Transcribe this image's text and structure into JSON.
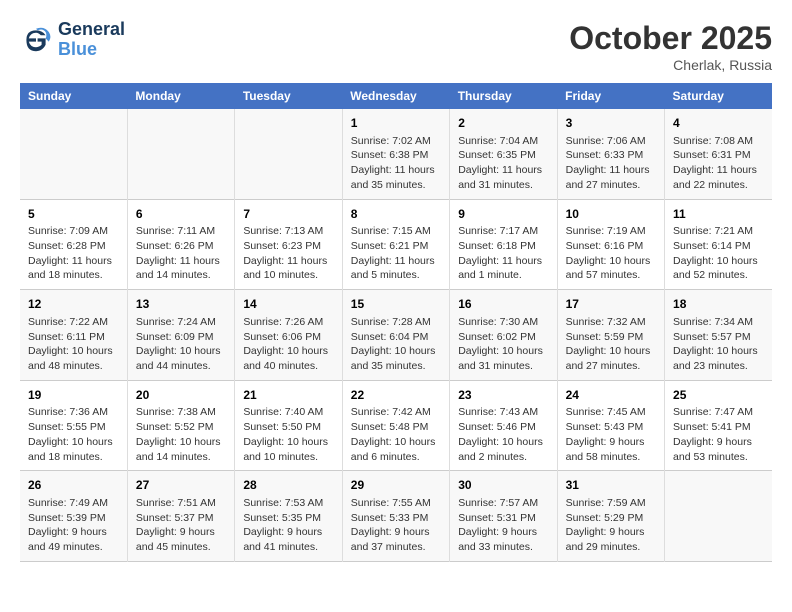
{
  "header": {
    "logo_line1": "General",
    "logo_line2": "Blue",
    "month": "October 2025",
    "location": "Cherlak, Russia"
  },
  "weekdays": [
    "Sunday",
    "Monday",
    "Tuesday",
    "Wednesday",
    "Thursday",
    "Friday",
    "Saturday"
  ],
  "weeks": [
    [
      {
        "day": "",
        "info": ""
      },
      {
        "day": "",
        "info": ""
      },
      {
        "day": "",
        "info": ""
      },
      {
        "day": "1",
        "info": "Sunrise: 7:02 AM\nSunset: 6:38 PM\nDaylight: 11 hours\nand 35 minutes."
      },
      {
        "day": "2",
        "info": "Sunrise: 7:04 AM\nSunset: 6:35 PM\nDaylight: 11 hours\nand 31 minutes."
      },
      {
        "day": "3",
        "info": "Sunrise: 7:06 AM\nSunset: 6:33 PM\nDaylight: 11 hours\nand 27 minutes."
      },
      {
        "day": "4",
        "info": "Sunrise: 7:08 AM\nSunset: 6:31 PM\nDaylight: 11 hours\nand 22 minutes."
      }
    ],
    [
      {
        "day": "5",
        "info": "Sunrise: 7:09 AM\nSunset: 6:28 PM\nDaylight: 11 hours\nand 18 minutes."
      },
      {
        "day": "6",
        "info": "Sunrise: 7:11 AM\nSunset: 6:26 PM\nDaylight: 11 hours\nand 14 minutes."
      },
      {
        "day": "7",
        "info": "Sunrise: 7:13 AM\nSunset: 6:23 PM\nDaylight: 11 hours\nand 10 minutes."
      },
      {
        "day": "8",
        "info": "Sunrise: 7:15 AM\nSunset: 6:21 PM\nDaylight: 11 hours\nand 5 minutes."
      },
      {
        "day": "9",
        "info": "Sunrise: 7:17 AM\nSunset: 6:18 PM\nDaylight: 11 hours\nand 1 minute."
      },
      {
        "day": "10",
        "info": "Sunrise: 7:19 AM\nSunset: 6:16 PM\nDaylight: 10 hours\nand 57 minutes."
      },
      {
        "day": "11",
        "info": "Sunrise: 7:21 AM\nSunset: 6:14 PM\nDaylight: 10 hours\nand 52 minutes."
      }
    ],
    [
      {
        "day": "12",
        "info": "Sunrise: 7:22 AM\nSunset: 6:11 PM\nDaylight: 10 hours\nand 48 minutes."
      },
      {
        "day": "13",
        "info": "Sunrise: 7:24 AM\nSunset: 6:09 PM\nDaylight: 10 hours\nand 44 minutes."
      },
      {
        "day": "14",
        "info": "Sunrise: 7:26 AM\nSunset: 6:06 PM\nDaylight: 10 hours\nand 40 minutes."
      },
      {
        "day": "15",
        "info": "Sunrise: 7:28 AM\nSunset: 6:04 PM\nDaylight: 10 hours\nand 35 minutes."
      },
      {
        "day": "16",
        "info": "Sunrise: 7:30 AM\nSunset: 6:02 PM\nDaylight: 10 hours\nand 31 minutes."
      },
      {
        "day": "17",
        "info": "Sunrise: 7:32 AM\nSunset: 5:59 PM\nDaylight: 10 hours\nand 27 minutes."
      },
      {
        "day": "18",
        "info": "Sunrise: 7:34 AM\nSunset: 5:57 PM\nDaylight: 10 hours\nand 23 minutes."
      }
    ],
    [
      {
        "day": "19",
        "info": "Sunrise: 7:36 AM\nSunset: 5:55 PM\nDaylight: 10 hours\nand 18 minutes."
      },
      {
        "day": "20",
        "info": "Sunrise: 7:38 AM\nSunset: 5:52 PM\nDaylight: 10 hours\nand 14 minutes."
      },
      {
        "day": "21",
        "info": "Sunrise: 7:40 AM\nSunset: 5:50 PM\nDaylight: 10 hours\nand 10 minutes."
      },
      {
        "day": "22",
        "info": "Sunrise: 7:42 AM\nSunset: 5:48 PM\nDaylight: 10 hours\nand 6 minutes."
      },
      {
        "day": "23",
        "info": "Sunrise: 7:43 AM\nSunset: 5:46 PM\nDaylight: 10 hours\nand 2 minutes."
      },
      {
        "day": "24",
        "info": "Sunrise: 7:45 AM\nSunset: 5:43 PM\nDaylight: 9 hours\nand 58 minutes."
      },
      {
        "day": "25",
        "info": "Sunrise: 7:47 AM\nSunset: 5:41 PM\nDaylight: 9 hours\nand 53 minutes."
      }
    ],
    [
      {
        "day": "26",
        "info": "Sunrise: 7:49 AM\nSunset: 5:39 PM\nDaylight: 9 hours\nand 49 minutes."
      },
      {
        "day": "27",
        "info": "Sunrise: 7:51 AM\nSunset: 5:37 PM\nDaylight: 9 hours\nand 45 minutes."
      },
      {
        "day": "28",
        "info": "Sunrise: 7:53 AM\nSunset: 5:35 PM\nDaylight: 9 hours\nand 41 minutes."
      },
      {
        "day": "29",
        "info": "Sunrise: 7:55 AM\nSunset: 5:33 PM\nDaylight: 9 hours\nand 37 minutes."
      },
      {
        "day": "30",
        "info": "Sunrise: 7:57 AM\nSunset: 5:31 PM\nDaylight: 9 hours\nand 33 minutes."
      },
      {
        "day": "31",
        "info": "Sunrise: 7:59 AM\nSunset: 5:29 PM\nDaylight: 9 hours\nand 29 minutes."
      },
      {
        "day": "",
        "info": ""
      }
    ]
  ]
}
